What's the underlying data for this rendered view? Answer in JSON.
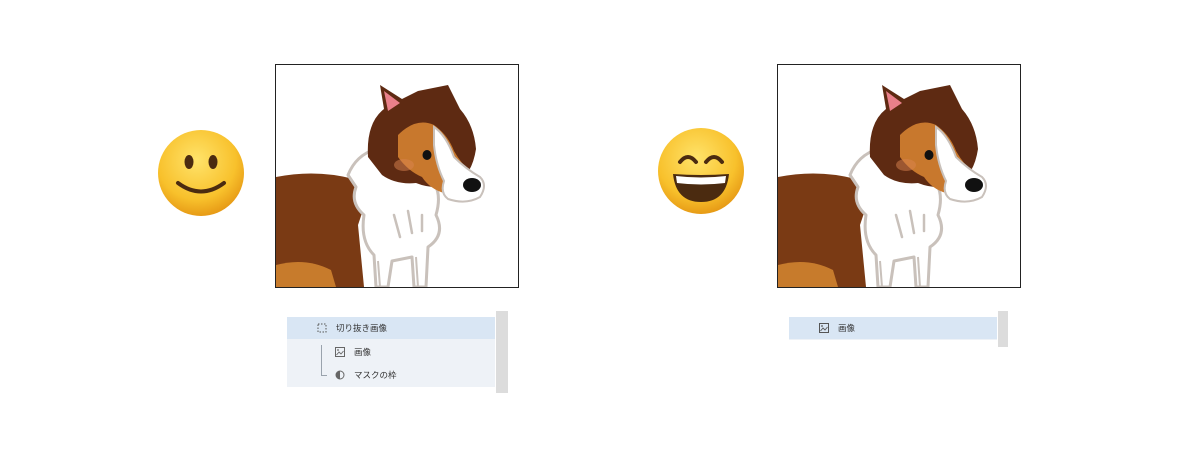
{
  "left_panel": {
    "emoji": "slight-smile-emoji",
    "layers": {
      "group_label": "切り抜き画像",
      "image_label": "画像",
      "mask_label": "マスクの枠"
    }
  },
  "right_panel": {
    "emoji": "grinning-smile-emoji",
    "layers": {
      "image_label": "画像"
    }
  },
  "colors": {
    "selected_row": "#d9e6f4",
    "panel_bg": "#eef2f7",
    "scrollbar": "#dcdcdc",
    "dog_dark_brown": "#5e2a12",
    "dog_light_brown": "#c2772e",
    "emoji_yellow": "#f7c12f"
  }
}
